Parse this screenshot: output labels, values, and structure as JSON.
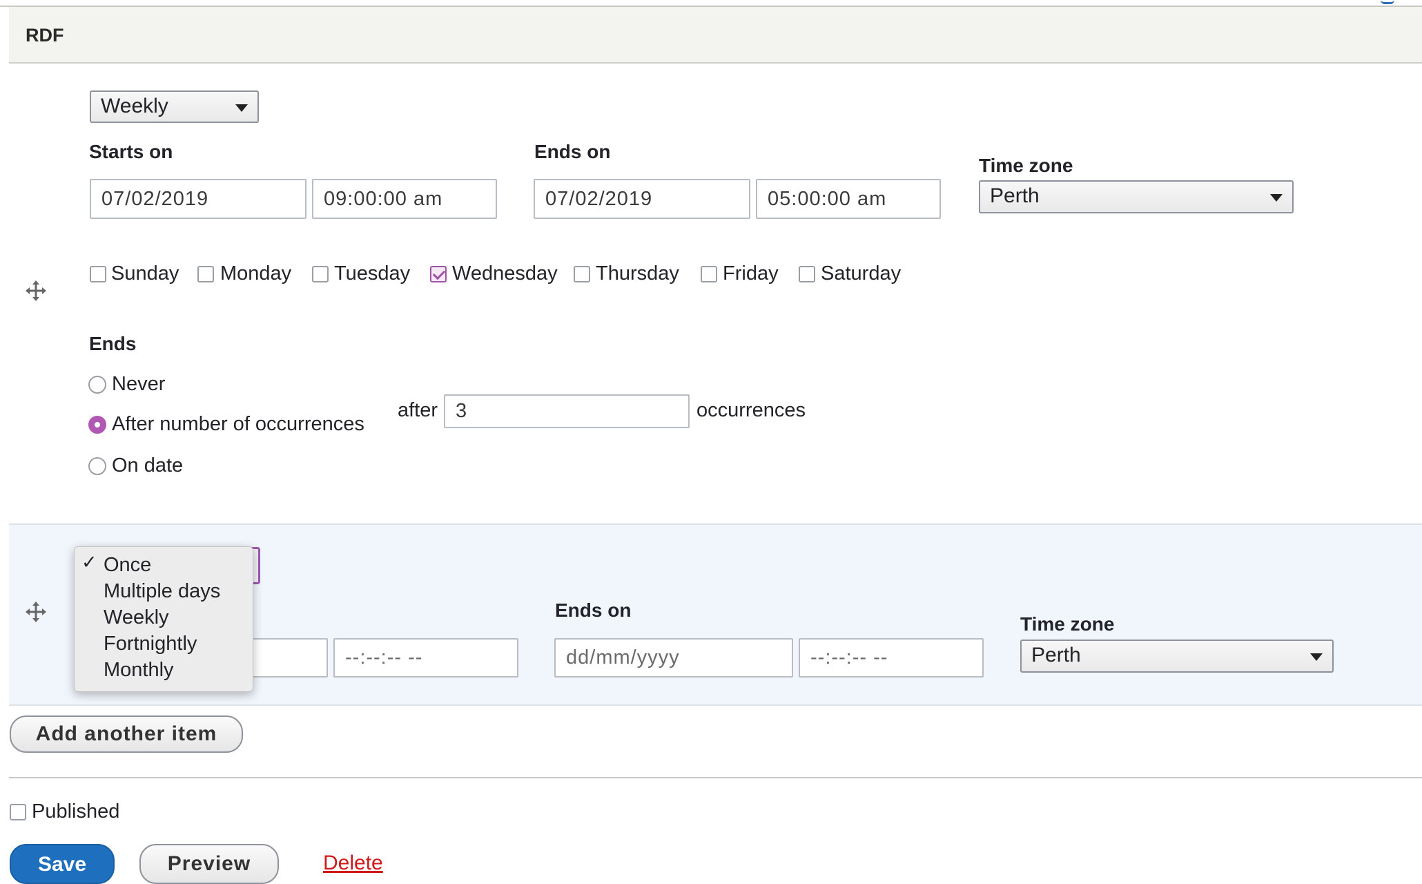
{
  "section": {
    "title": "RDF"
  },
  "item1": {
    "repeat": "Weekly",
    "starts_on_label": "Starts on",
    "start_date": "07/02/2019",
    "start_time": "09:00:00  am",
    "ends_on_label": "Ends on",
    "end_date": "07/02/2019",
    "end_time": "05:00:00  am",
    "timezone_label": "Time zone",
    "timezone": "Perth",
    "days": [
      {
        "label": "Sunday",
        "checked": false
      },
      {
        "label": "Monday",
        "checked": false
      },
      {
        "label": "Tuesday",
        "checked": false
      },
      {
        "label": "Wednesday",
        "checked": true
      },
      {
        "label": "Thursday",
        "checked": false
      },
      {
        "label": "Friday",
        "checked": false
      },
      {
        "label": "Saturday",
        "checked": false
      }
    ],
    "ends_label": "Ends",
    "ends_options": [
      {
        "label": "Never",
        "selected": false
      },
      {
        "label": "After number of occurrences",
        "selected": true
      },
      {
        "label": "On date",
        "selected": false
      }
    ],
    "after_label": "after",
    "occurrences_value": "3",
    "occurrences_label": "occurrences"
  },
  "item2": {
    "ends_on_label": "Ends on",
    "start_date_partial": "",
    "start_time_placeholder": "--:--:--  --",
    "end_date_placeholder": "dd/mm/yyyy",
    "end_time_placeholder": "--:--:--  --",
    "timezone_label": "Time zone",
    "timezone": "Perth",
    "dropdown": {
      "selected": "Once",
      "options": [
        "Once",
        "Multiple days",
        "Weekly",
        "Fortnightly",
        "Monthly"
      ]
    }
  },
  "add_another_label": "Add another item",
  "published_label": "Published",
  "actions": {
    "save": "Save",
    "preview": "Preview",
    "delete": "Delete"
  },
  "colors": {
    "accent": "#b158b5",
    "primary": "#1f6fbf",
    "danger": "#d01a1a",
    "row_highlight": "#f0f6fc"
  },
  "icons": {
    "drag": "move-arrows-icon",
    "checkmark": "checkmark-icon",
    "caret": "caret-down-icon"
  }
}
